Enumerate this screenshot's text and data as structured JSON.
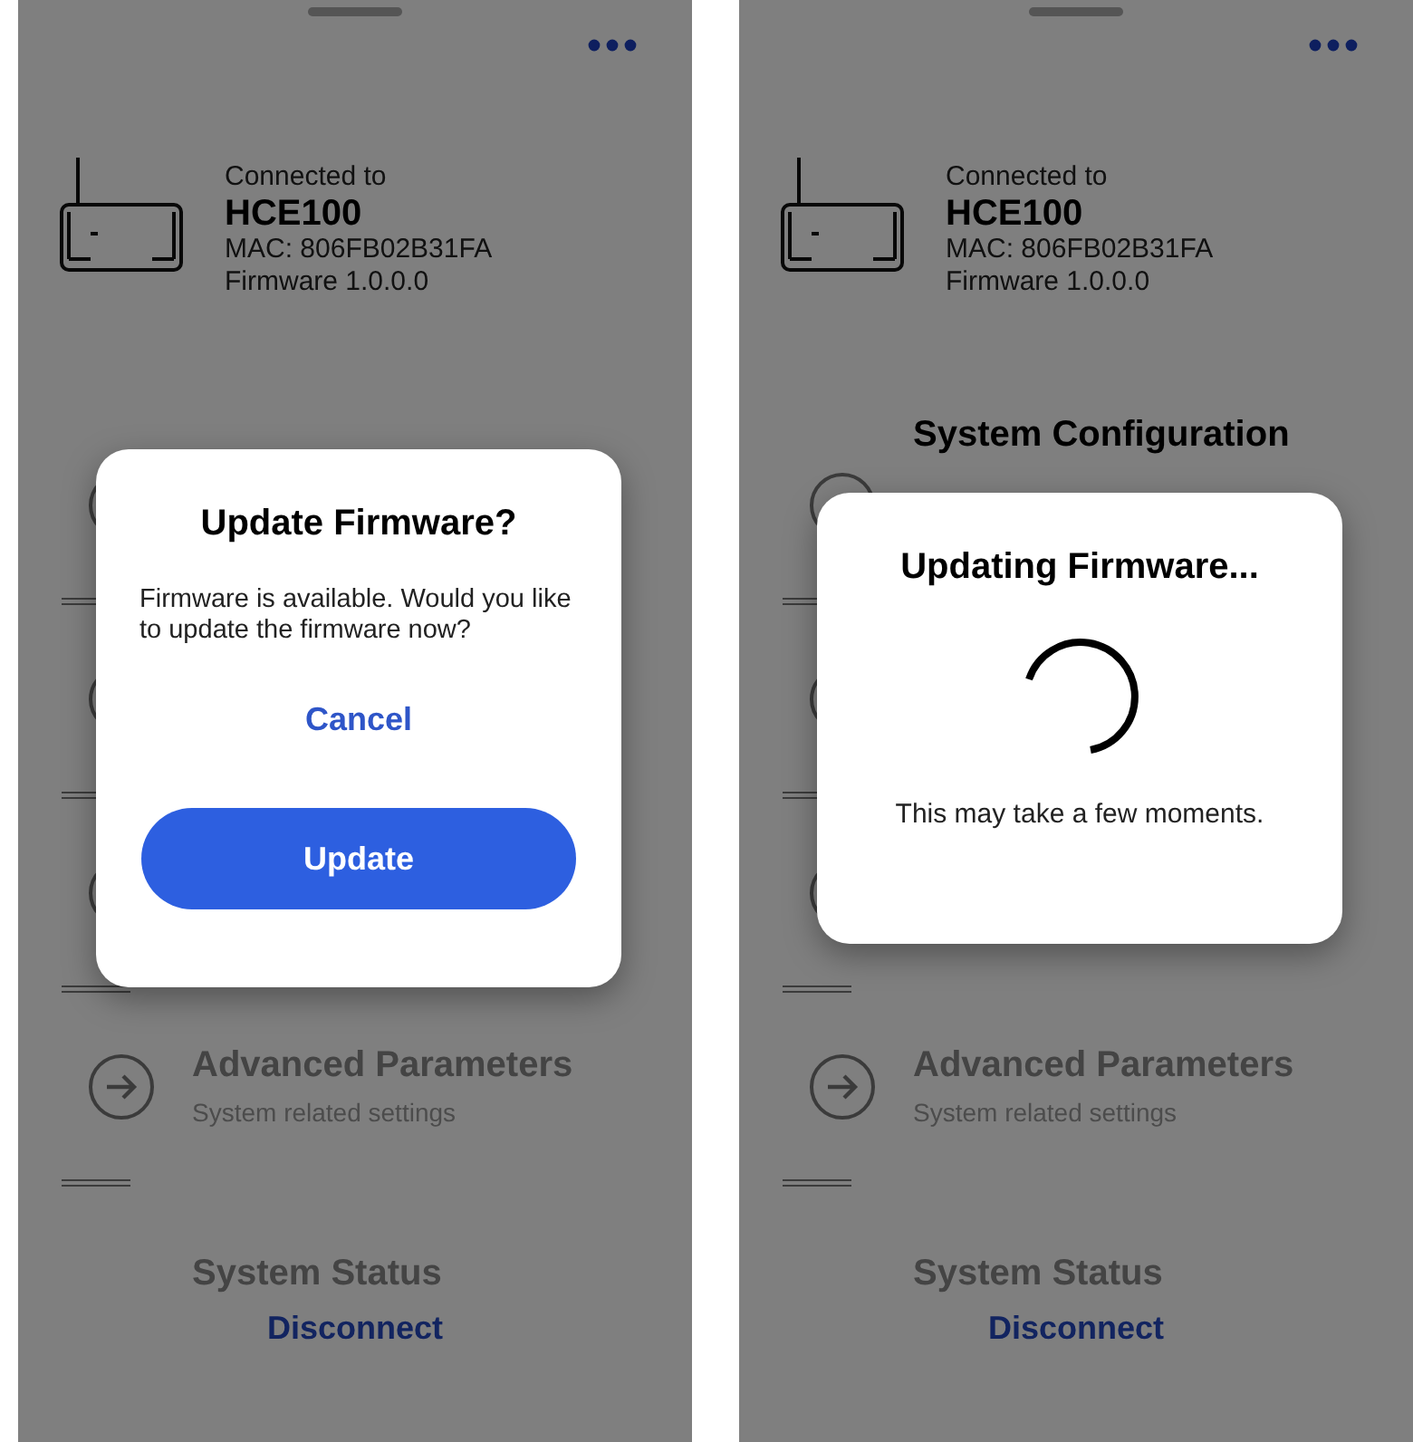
{
  "screens": [
    {
      "device": {
        "status": "Connected to",
        "name": "HCE100",
        "mac": "MAC: 806FB02B31FA",
        "firmware": "Firmware 1.0.0.0"
      },
      "rows": [
        {
          "kind": "arrow"
        },
        {
          "kind": "arrow"
        },
        {
          "kind": "arrow"
        },
        {
          "kind": "arrow",
          "title": "Advanced Parameters",
          "subtitle": "System related settings"
        },
        {
          "kind": "plain",
          "title": "System Status"
        }
      ],
      "disconnect": "Disconnect",
      "dialog": {
        "kind": "confirm",
        "title": "Update Firmware?",
        "message": "Firmware is available. Would you like to update the firmware now?",
        "cancel": "Cancel",
        "confirm": "Update"
      }
    },
    {
      "device": {
        "status": "Connected to",
        "name": "HCE100",
        "mac": "MAC: 806FB02B31FA",
        "firmware": "Firmware 1.0.0.0"
      },
      "rows": [
        {
          "kind": "arrow",
          "title": "System Configuration"
        },
        {
          "kind": "arrow"
        },
        {
          "kind": "arrow"
        },
        {
          "kind": "arrow",
          "title": "Advanced Parameters",
          "subtitle": "System related settings"
        },
        {
          "kind": "plain",
          "title": "System Status"
        }
      ],
      "disconnect": "Disconnect",
      "dialog": {
        "kind": "progress",
        "title": "Updating Firmware...",
        "message": "This may take a few moments."
      }
    }
  ]
}
